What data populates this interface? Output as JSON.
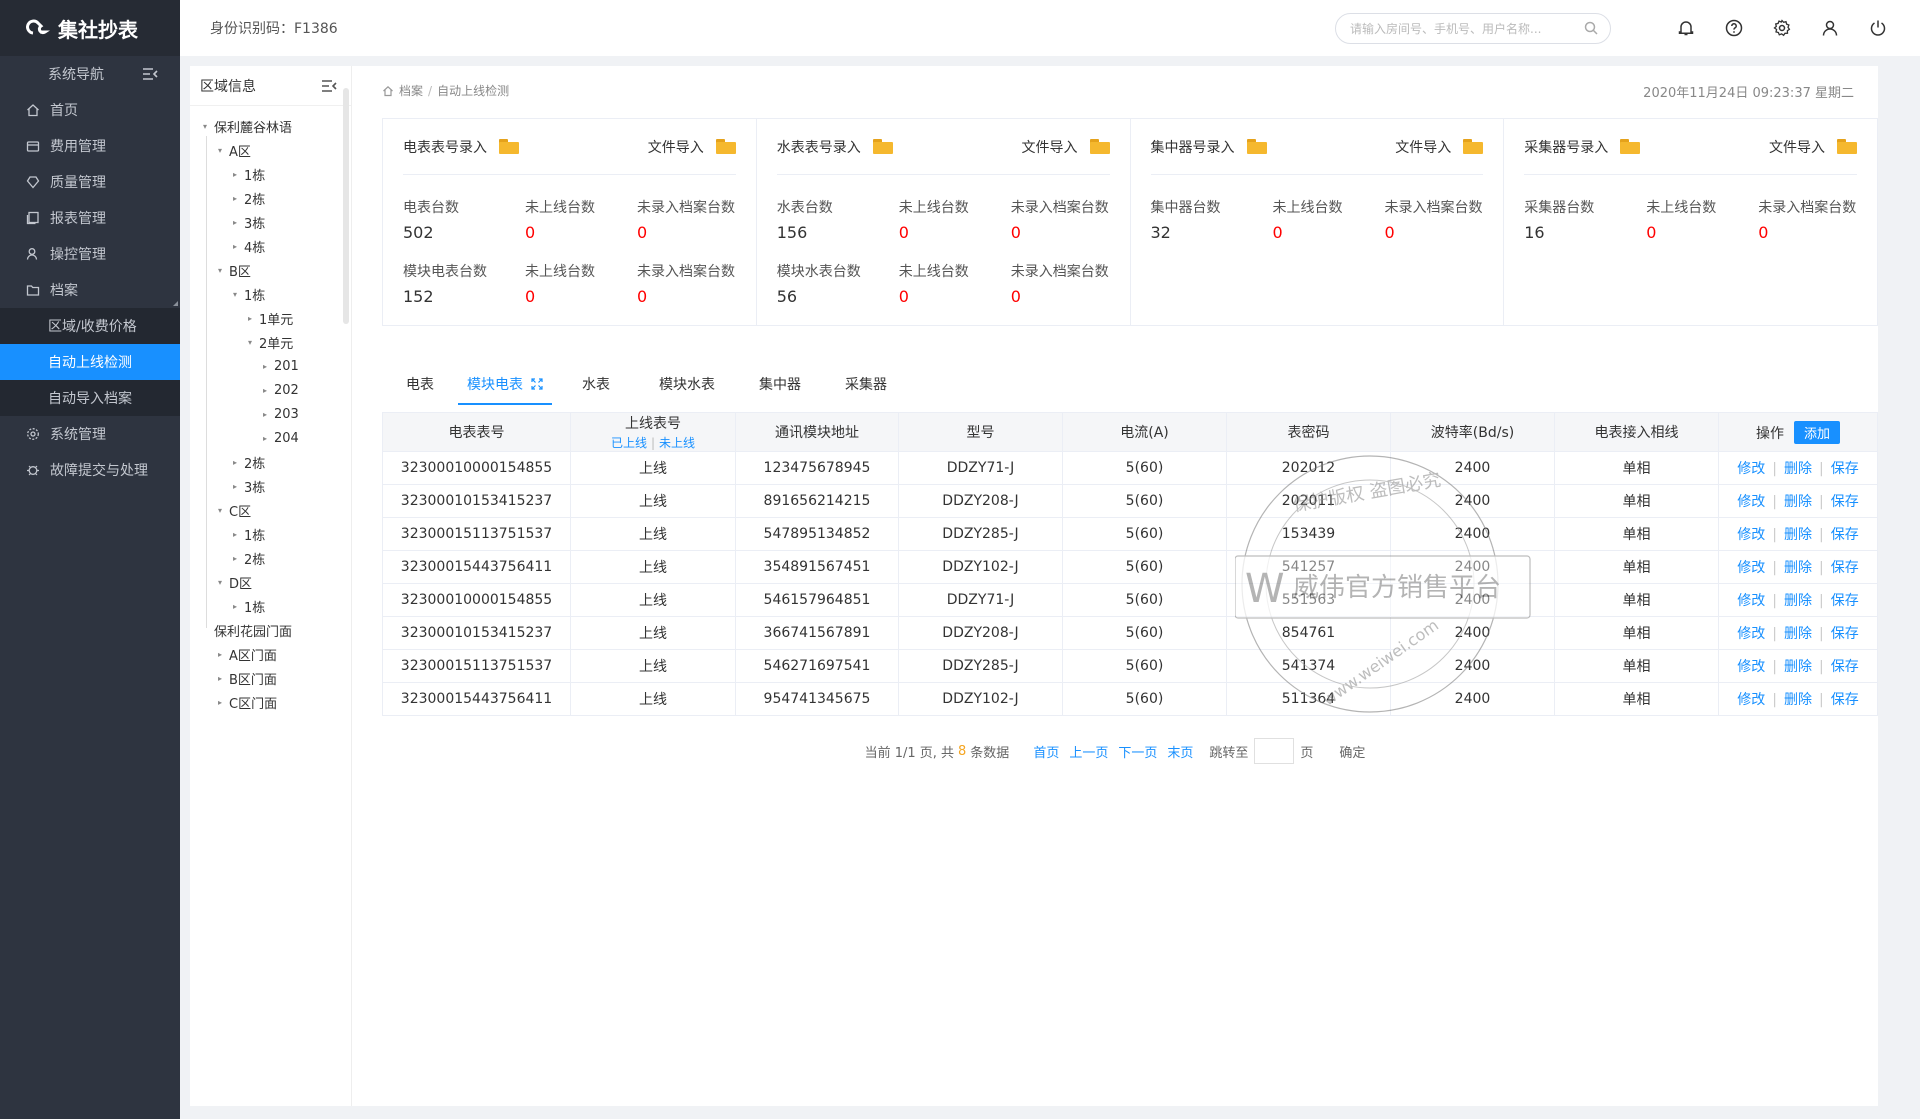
{
  "app": {
    "name": "集社抄表"
  },
  "sidebar": {
    "header": "系统导航",
    "items": [
      {
        "label": "首页",
        "icon": "home-icon"
      },
      {
        "label": "费用管理",
        "icon": "wallet-icon"
      },
      {
        "label": "质量管理",
        "icon": "quality-icon"
      },
      {
        "label": "报表管理",
        "icon": "report-icon"
      },
      {
        "label": "操控管理",
        "icon": "user-control-icon"
      },
      {
        "label": "档案",
        "icon": "folder-icon"
      }
    ],
    "subitems": [
      {
        "label": "区域/收费价格"
      },
      {
        "label": "自动上线检测"
      },
      {
        "label": "自动导入档案"
      }
    ],
    "bottom_items": [
      {
        "label": "系统管理",
        "icon": "gear-icon"
      },
      {
        "label": "故障提交与处理",
        "icon": "bug-icon"
      }
    ]
  },
  "topbar": {
    "id_label": "身份识别码：F1386",
    "search_placeholder": "请输入房间号、手机号、用户名称..."
  },
  "area_panel": {
    "title": "区域信息",
    "tree": [
      {
        "label": "保利麓谷林语",
        "level": 0,
        "arrow": "down"
      },
      {
        "label": "A区",
        "level": 1,
        "arrow": "down"
      },
      {
        "label": "1栋",
        "level": 2,
        "arrow": "right"
      },
      {
        "label": "2栋",
        "level": 2,
        "arrow": "right"
      },
      {
        "label": "3栋",
        "level": 2,
        "arrow": "right"
      },
      {
        "label": "4栋",
        "level": 2,
        "arrow": "right"
      },
      {
        "label": "B区",
        "level": 1,
        "arrow": "down"
      },
      {
        "label": "1栋",
        "level": 2,
        "arrow": "down"
      },
      {
        "label": "1单元",
        "level": 3,
        "arrow": "right"
      },
      {
        "label": "2单元",
        "level": 3,
        "arrow": "down"
      },
      {
        "label": "201",
        "level": 4,
        "arrow": "right"
      },
      {
        "label": "202",
        "level": 4,
        "arrow": "right"
      },
      {
        "label": "203",
        "level": 4,
        "arrow": "right"
      },
      {
        "label": "204",
        "level": 4,
        "arrow": "right"
      },
      {
        "label": "2栋",
        "level": 2,
        "arrow": "right"
      },
      {
        "label": "3栋",
        "level": 2,
        "arrow": "right"
      },
      {
        "label": "C区",
        "level": 1,
        "arrow": "down"
      },
      {
        "label": "1栋",
        "level": 2,
        "arrow": "right"
      },
      {
        "label": "2栋",
        "level": 2,
        "arrow": "right"
      },
      {
        "label": "D区",
        "level": 1,
        "arrow": "down"
      },
      {
        "label": "1栋",
        "level": 2,
        "arrow": "right"
      },
      {
        "label": "保利花园门面",
        "level": 0,
        "arrow": ""
      },
      {
        "label": "A区门面",
        "level": 1,
        "arrow": "right"
      },
      {
        "label": "B区门面",
        "level": 1,
        "arrow": "right"
      },
      {
        "label": "C区门面",
        "level": 1,
        "arrow": "right"
      }
    ]
  },
  "breadcrumb": {
    "home": "档案",
    "current": "自动上线检测"
  },
  "datetime": "2020年11月24日 09:23:37 星期二",
  "cards": [
    {
      "entry": "电表表号录入",
      "import": "文件导入",
      "stats": [
        {
          "label": "电表台数",
          "value": "502",
          "red": false
        },
        {
          "label": "未上线台数",
          "value": "0",
          "red": true
        },
        {
          "label": "未录入档案台数",
          "value": "0",
          "red": true
        },
        {
          "label": "模块电表台数",
          "value": "152",
          "red": false
        },
        {
          "label": "未上线台数",
          "value": "0",
          "red": true
        },
        {
          "label": "未录入档案台数",
          "value": "0",
          "red": true
        }
      ]
    },
    {
      "entry": "水表表号录入",
      "import": "文件导入",
      "stats": [
        {
          "label": "水表台数",
          "value": "156",
          "red": false
        },
        {
          "label": "未上线台数",
          "value": "0",
          "red": true
        },
        {
          "label": "未录入档案台数",
          "value": "0",
          "red": true
        },
        {
          "label": "模块水表台数",
          "value": "56",
          "red": false
        },
        {
          "label": "未上线台数",
          "value": "0",
          "red": true
        },
        {
          "label": "未录入档案台数",
          "value": "0",
          "red": true
        }
      ]
    },
    {
      "entry": "集中器号录入",
      "import": "文件导入",
      "stats": [
        {
          "label": "集中器台数",
          "value": "32",
          "red": false
        },
        {
          "label": "未上线台数",
          "value": "0",
          "red": true
        },
        {
          "label": "未录入档案台数",
          "value": "0",
          "red": true
        }
      ]
    },
    {
      "entry": "采集器号录入",
      "import": "文件导入",
      "stats": [
        {
          "label": "采集器台数",
          "value": "16",
          "red": false
        },
        {
          "label": "未上线台数",
          "value": "0",
          "red": true
        },
        {
          "label": "未录入档案台数",
          "value": "0",
          "red": true
        }
      ]
    }
  ],
  "tabs": [
    {
      "label": "电表",
      "active": false
    },
    {
      "label": "模块电表",
      "active": true
    },
    {
      "label": "水表",
      "active": false
    },
    {
      "label": "模块水表",
      "active": false
    },
    {
      "label": "集中器",
      "active": false
    },
    {
      "label": "采集器",
      "active": false
    }
  ],
  "table": {
    "headers": [
      "电表表号",
      "上线表号",
      "通讯模块地址",
      "型号",
      "电流(A)",
      "表密码",
      "波特率(Bd/s)",
      "电表接入相线",
      "操作"
    ],
    "online_filter": {
      "online": "已上线",
      "offline": "未上线"
    },
    "add_label": "添加",
    "actions": {
      "edit": "修改",
      "delete": "删除",
      "save": "保存"
    },
    "rows": [
      [
        "32300010000154855",
        "上线",
        "123475678945",
        "DDZY71-J",
        "5(60)",
        "202012",
        "2400",
        "单相"
      ],
      [
        "32300010153415237",
        "上线",
        "891656214215",
        "DDZY208-J",
        "5(60)",
        "202011",
        "2400",
        "单相"
      ],
      [
        "32300015113751537",
        "上线",
        "547895134852",
        "DDZY285-J",
        "5(60)",
        "153439",
        "2400",
        "单相"
      ],
      [
        "32300015443756411",
        "上线",
        "354891567451",
        "DDZY102-J",
        "5(60)",
        "541257",
        "2400",
        "单相"
      ],
      [
        "32300010000154855",
        "上线",
        "546157964851",
        "DDZY71-J",
        "5(60)",
        "551563",
        "2400",
        "单相"
      ],
      [
        "32300010153415237",
        "上线",
        "366741567891",
        "DDZY208-J",
        "5(60)",
        "854761",
        "2400",
        "单相"
      ],
      [
        "32300015113751537",
        "上线",
        "546271697541",
        "DDZY285-J",
        "5(60)",
        "541374",
        "2400",
        "单相"
      ],
      [
        "32300015443756411",
        "上线",
        "954741345675",
        "DDZY102-J",
        "5(60)",
        "511364",
        "2400",
        "单相"
      ]
    ]
  },
  "pager": {
    "prefix": "当前 1/1 页, 共",
    "count": "8",
    "suffix": "条数据",
    "first": "首页",
    "prev": "上一页",
    "next": "下一页",
    "last": "末页",
    "jump_label": "跳转至",
    "page_unit": "页",
    "confirm": "确定"
  },
  "watermark": {
    "logo_text": "W",
    "main_text": "威伟官方销售平台",
    "stamp_text": "保护版权 盗图必究",
    "url_text": "www.weiwei.com"
  }
}
